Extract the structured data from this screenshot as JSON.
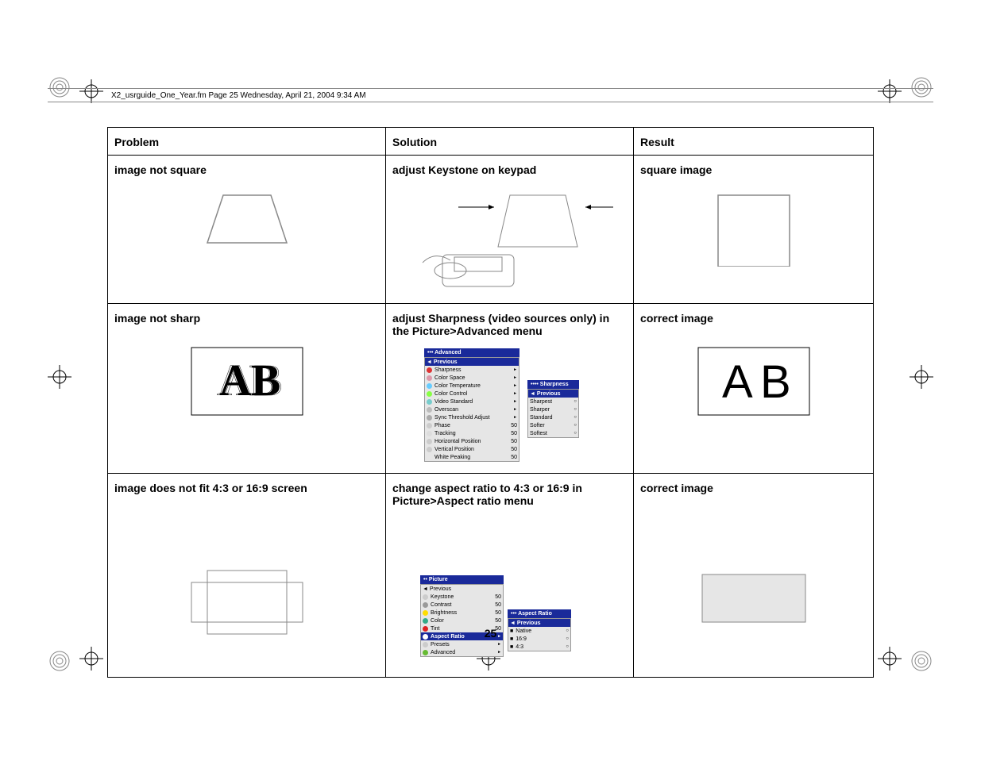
{
  "header": "X2_usrguide_One_Year.fm  Page 25  Wednesday, April 21, 2004  9:34 AM",
  "table": {
    "headers": {
      "problem": "Problem",
      "solution": "Solution",
      "result": "Result"
    },
    "rows": [
      {
        "problem": "image not square",
        "solution": "adjust Keystone on keypad",
        "result": "square image"
      },
      {
        "problem": "image not sharp",
        "solution": "adjust Sharpness (video sources only) in the Picture>Advanced menu",
        "result": "correct image"
      },
      {
        "problem": "image does not fit 4:3 or 16:9 screen",
        "solution": "change aspect ratio to 4:3 or 16:9 in Picture>Aspect ratio menu",
        "result": "correct image"
      }
    ]
  },
  "page_number": "25",
  "menus": {
    "advanced": {
      "title": "•••  Advanced",
      "prev": "◄  Previous",
      "items": [
        {
          "ico": "#d33",
          "label": "Sharpness"
        },
        {
          "ico": "#d9a",
          "label": "Color Space"
        },
        {
          "ico": "#6cf",
          "label": "Color Temperature"
        },
        {
          "ico": "#8f4",
          "label": "Color Control"
        },
        {
          "ico": "#7cc",
          "label": "Video Standard"
        },
        {
          "ico": "#bbb",
          "label": "Overscan"
        },
        {
          "ico": "#aaa",
          "label": "Sync Threshold Adjust"
        },
        {
          "ico": "#ccc",
          "label": "Phase",
          "val": "50"
        },
        {
          "ico": "#ddd",
          "label": "Tracking",
          "val": "50"
        },
        {
          "ico": "#ccc",
          "label": "Horizontal Position",
          "val": "50"
        },
        {
          "ico": "#ccc",
          "label": "Vertical Position",
          "val": "50"
        },
        {
          "ico": "none",
          "label": "White Peaking",
          "val": "50"
        }
      ]
    },
    "sharpness": {
      "title": "••••  Sharpness",
      "prev": "◄  Previous",
      "items": [
        "Sharpest",
        "Sharper",
        "Standard",
        "Softer",
        "Softest"
      ]
    },
    "picture": {
      "title": "••  Picture",
      "prev": "◄  Previous",
      "items": [
        {
          "ico": "#ccc",
          "label": "Keystone",
          "val": "50"
        },
        {
          "ico": "#999",
          "label": "Contrast",
          "val": "50"
        },
        {
          "ico": "#fd0",
          "label": "Brightness",
          "val": "50"
        },
        {
          "ico": "#3a8",
          "label": "Color",
          "val": "50"
        },
        {
          "ico": "#d22",
          "label": "Tint",
          "val": "50"
        },
        {
          "ico": "#fff",
          "label": "Aspect Ratio",
          "hl": true
        },
        {
          "ico": "#ccc",
          "label": "Presets"
        },
        {
          "ico": "#6b3",
          "label": "Advanced"
        }
      ]
    },
    "aspect": {
      "title": "•••  Aspect Ratio",
      "prev": "◄  Previous",
      "items": [
        "Native",
        "16:9",
        "4:3"
      ]
    }
  }
}
